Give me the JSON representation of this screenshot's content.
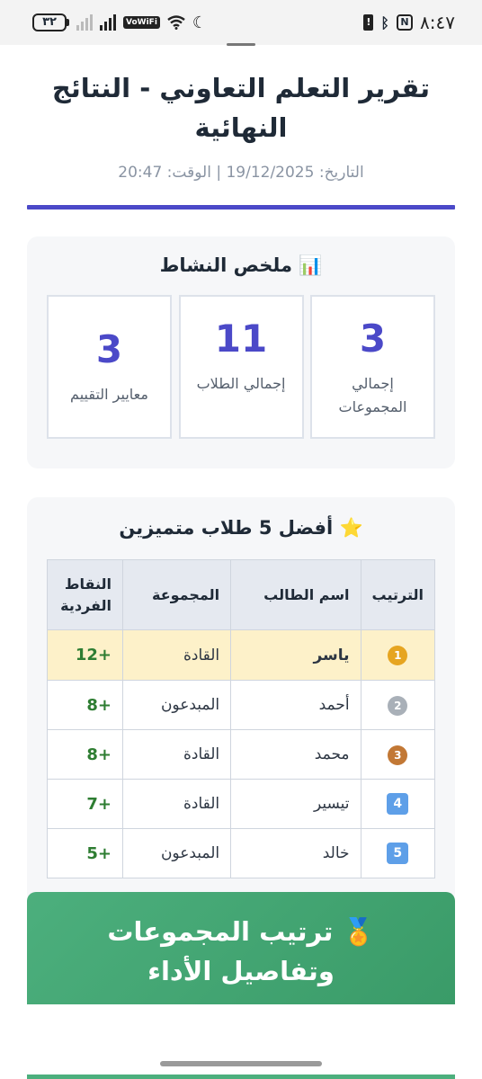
{
  "status_bar": {
    "battery": "٣٢",
    "vowifi": "VoWiFi",
    "signal_sub": "1",
    "time": "٨:٤٧",
    "nfc": "N",
    "bluetooth": "ᛒ"
  },
  "report": {
    "title": "تقرير التعلم التعاوني - النتائج النهائية",
    "date_line": "التاريخ: 19/12/2025 | الوقت: 20:47"
  },
  "summary": {
    "title": "📊 ملخص النشاط",
    "stats": [
      {
        "value": "3",
        "label": "إجمالي المجموعات"
      },
      {
        "value": "11",
        "label": "إجمالي الطلاب"
      },
      {
        "value": "3",
        "label": "معايير التقييم"
      }
    ]
  },
  "top_students": {
    "title": "⭐ أفضل 5 طلاب متميزين",
    "headers": {
      "rank": "الترتيب",
      "name": "اسم الطالب",
      "group": "المجموعة",
      "points": "النقاط الفردية"
    },
    "rows": [
      {
        "rank": "1",
        "rank_icon": "gold-medal-icon",
        "name": "ياسر",
        "group": "القادة",
        "points": "+12"
      },
      {
        "rank": "2",
        "rank_icon": "silver-medal-icon",
        "name": "أحمد",
        "group": "المبدعون",
        "points": "+8"
      },
      {
        "rank": "3",
        "rank_icon": "bronze-medal-icon",
        "name": "محمد",
        "group": "القادة",
        "points": "+8"
      },
      {
        "rank": "4",
        "rank_icon": "keycap-4-icon",
        "name": "تيسير",
        "group": "القادة",
        "points": "+7"
      },
      {
        "rank": "5",
        "rank_icon": "keycap-5-icon",
        "name": "خالد",
        "group": "المبدعون",
        "points": "+5"
      }
    ]
  },
  "groups_section": {
    "title": "🏅 ترتيب المجموعات وتفاصيل الأداء"
  },
  "colors": {
    "accent": "#4b49c8",
    "points_green": "#2e7d32",
    "banner_green": "#3a9b68",
    "highlight_row": "#fdf1c9"
  }
}
